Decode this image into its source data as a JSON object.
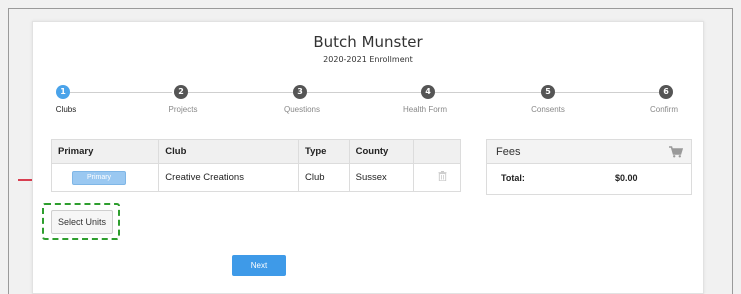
{
  "header": {
    "name": "Butch Munster",
    "subtitle": "2020-2021 Enrollment"
  },
  "steps": [
    {
      "number": "1",
      "label": "Clubs",
      "active": true
    },
    {
      "number": "2",
      "label": "Projects",
      "active": false
    },
    {
      "number": "3",
      "label": "Questions",
      "active": false
    },
    {
      "number": "4",
      "label": "Health Form",
      "active": false
    },
    {
      "number": "5",
      "label": "Consents",
      "active": false
    },
    {
      "number": "6",
      "label": "Confirm",
      "active": false
    }
  ],
  "clubs_table": {
    "headers": [
      "Primary",
      "Club",
      "Type",
      "County",
      ""
    ],
    "rows": [
      {
        "primary_label": "Primary",
        "club": "Creative Creations",
        "type": "Club",
        "county": "Sussex"
      }
    ]
  },
  "fees": {
    "title": "Fees",
    "total_label": "Total:",
    "total_value": "$0.00"
  },
  "buttons": {
    "select_units": "Select Units",
    "next": "Next"
  },
  "colors": {
    "accent": "#3e9ae8",
    "active_step": "#4aa3ea",
    "highlight_border": "#2e9e2e",
    "arrow": "#d0021b"
  }
}
